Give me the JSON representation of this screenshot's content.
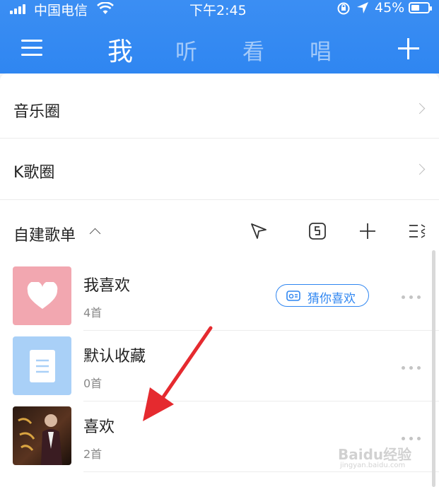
{
  "status_bar": {
    "carrier": "中国电信",
    "time": "下午2:45",
    "battery": "45%",
    "icons": [
      "signal-icon",
      "wifi-icon",
      "orientation-lock-icon",
      "location-icon",
      "battery-icon"
    ]
  },
  "nav": {
    "tabs": [
      {
        "label": "我",
        "active": true
      },
      {
        "label": "听",
        "active": false
      },
      {
        "label": "看",
        "active": false
      },
      {
        "label": "唱",
        "active": false
      }
    ],
    "icons": [
      "menu-icon",
      "plus-icon"
    ]
  },
  "circles": [
    {
      "label": "音乐圈"
    },
    {
      "label": "K歌圈"
    }
  ],
  "playlists_section": {
    "title": "自建歌单",
    "tools": [
      "share-icon",
      "import-icon",
      "add-icon",
      "manage-icon"
    ]
  },
  "playlists": [
    {
      "title": "我喜欢",
      "count": "4首",
      "cover": "heart-cover"
    },
    {
      "title": "默认收藏",
      "count": "0首",
      "cover": "document-cover"
    },
    {
      "title": "喜欢",
      "count": "2首",
      "cover": "album-cover"
    }
  ],
  "guess_button": {
    "label": "猜你喜欢",
    "icon": "radio-icon"
  },
  "watermark": {
    "text": "Baidu经验",
    "sub": "jingyan.baidu.com"
  },
  "colors": {
    "header": "#2f86f1",
    "accent": "#2f86f1",
    "heart_cover": "#f2a7b0",
    "doc_cover": "#a9d0f7",
    "arrow": "#e52a2f"
  }
}
